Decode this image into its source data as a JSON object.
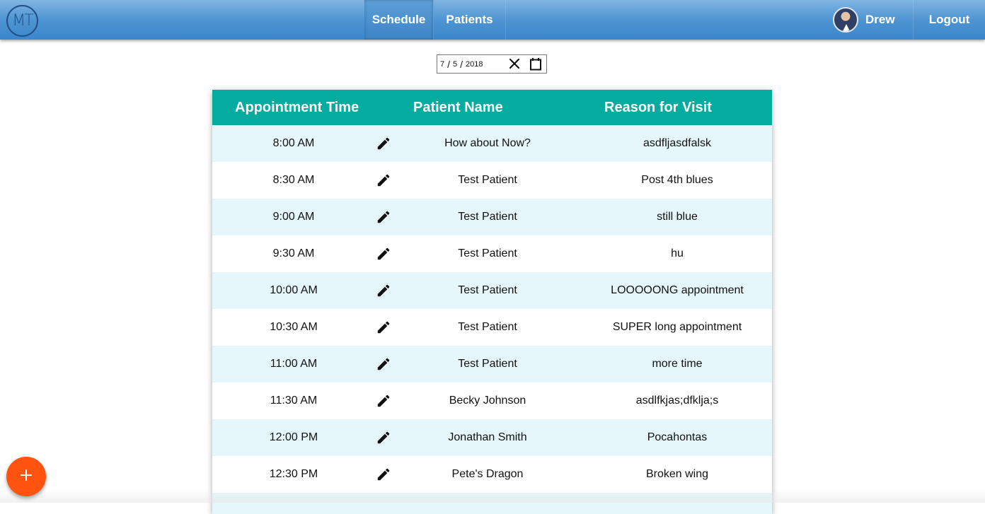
{
  "navbar": {
    "logo_text": "MT",
    "tabs": [
      {
        "label": "Schedule",
        "active": true
      },
      {
        "label": "Patients",
        "active": false
      }
    ],
    "user_name": "Drew",
    "logout_label": "Logout",
    "gradient_top": "#7fb5e2",
    "gradient_bottom": "#3a86cb"
  },
  "date_filter": {
    "month": "7",
    "day": "5",
    "year": "2018",
    "clear_icon": "close-icon",
    "calendar_icon": "calendar-icon"
  },
  "schedule_table": {
    "header_color": "#03ac9f",
    "stripe_color": "#e5f7fa",
    "headers": {
      "time": "Appointment Time",
      "name": "Patient Name",
      "reason": "Reason for Visit"
    },
    "rows": [
      {
        "time": "8:00 AM",
        "name": "How about Now?",
        "reason": "asdfljasdfalsk"
      },
      {
        "time": "8:30 AM",
        "name": "Test Patient",
        "reason": "Post 4th blues"
      },
      {
        "time": "9:00 AM",
        "name": "Test Patient",
        "reason": "still blue"
      },
      {
        "time": "9:30 AM",
        "name": "Test Patient",
        "reason": "hu"
      },
      {
        "time": "10:00 AM",
        "name": "Test Patient",
        "reason": "LOOOOONG appointment"
      },
      {
        "time": "10:30 AM",
        "name": "Test Patient",
        "reason": "SUPER long appointment"
      },
      {
        "time": "11:00 AM",
        "name": "Test Patient",
        "reason": "more time"
      },
      {
        "time": "11:30 AM",
        "name": "Becky Johnson",
        "reason": "asdlfkjas;dfklja;s"
      },
      {
        "time": "12:00 PM",
        "name": "Jonathan Smith",
        "reason": "Pocahontas"
      },
      {
        "time": "12:30 PM",
        "name": "Pete's Dragon",
        "reason": "Broken wing"
      }
    ]
  },
  "fab": {
    "icon": "plus-icon",
    "color": "#ff5310"
  }
}
